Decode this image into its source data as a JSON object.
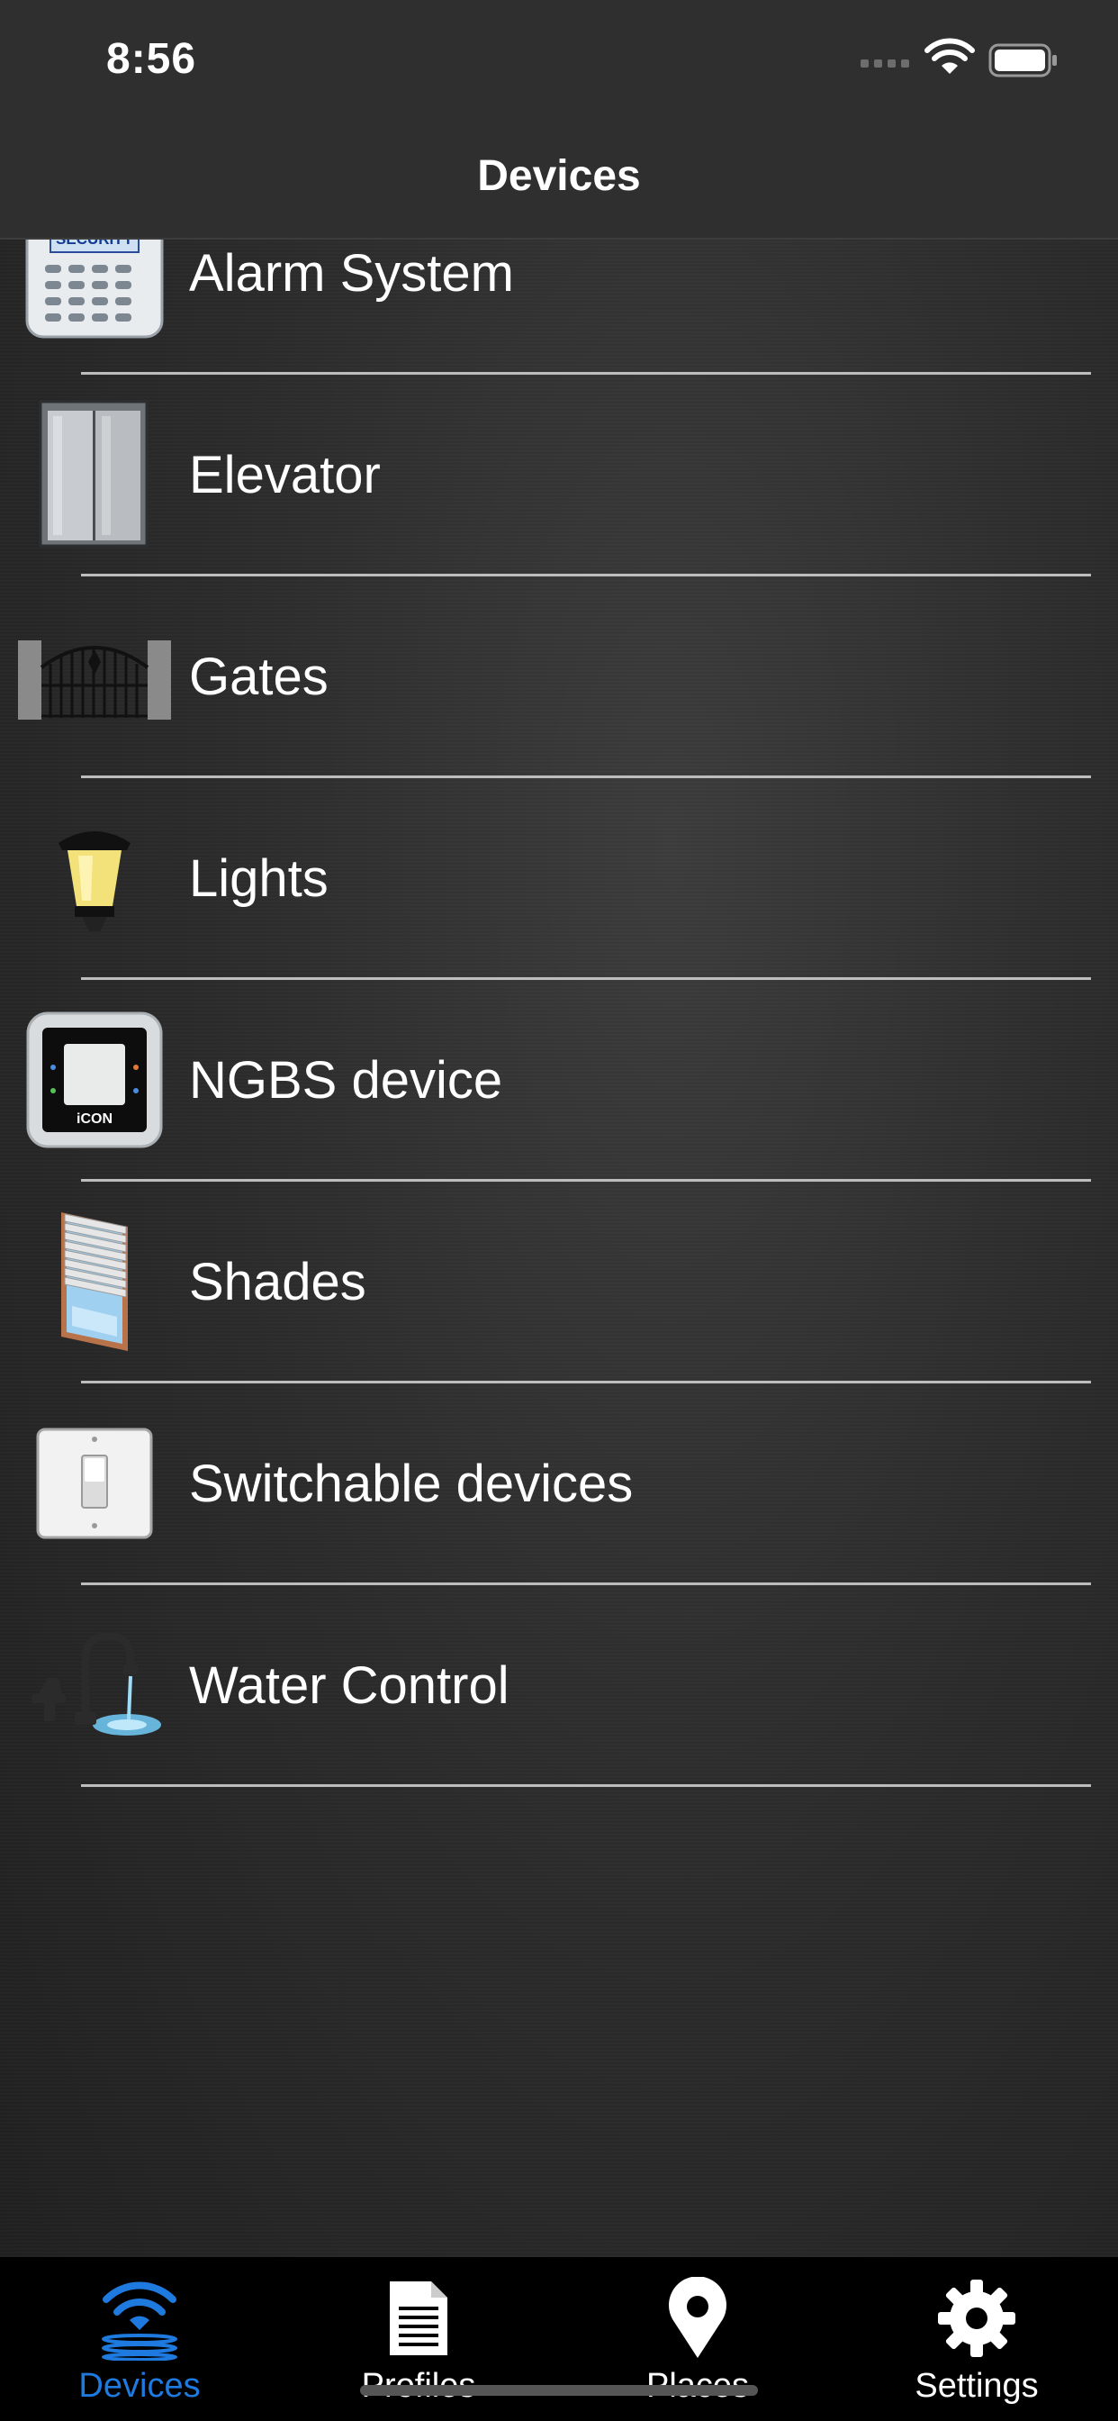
{
  "status_bar": {
    "time": "8:56"
  },
  "nav": {
    "title": "Devices"
  },
  "devices": [
    {
      "label": "Alarm System",
      "icon": "security-keypad-icon"
    },
    {
      "label": "Elevator",
      "icon": "elevator-icon"
    },
    {
      "label": "Gates",
      "icon": "gate-icon"
    },
    {
      "label": "Lights",
      "icon": "lamp-icon"
    },
    {
      "label": "NGBS device",
      "icon": "icon-panel-icon"
    },
    {
      "label": "Shades",
      "icon": "window-shade-icon"
    },
    {
      "label": "Switchable devices",
      "icon": "light-switch-icon"
    },
    {
      "label": "Water Control",
      "icon": "faucet-icon"
    }
  ],
  "alarm_icon_text": "SECURITY",
  "ngbs_icon_text": "iCON",
  "tabs": [
    {
      "label": "Devices",
      "icon": "devices-wifi-icon",
      "active": true
    },
    {
      "label": "Profiles",
      "icon": "document-icon",
      "active": false
    },
    {
      "label": "Places",
      "icon": "map-pin-icon",
      "active": false
    },
    {
      "label": "Settings",
      "icon": "gear-icon",
      "active": false
    }
  ],
  "colors": {
    "accent": "#1f7ae0",
    "background": "#2a2a2a",
    "separator": "#bdbdbd"
  }
}
